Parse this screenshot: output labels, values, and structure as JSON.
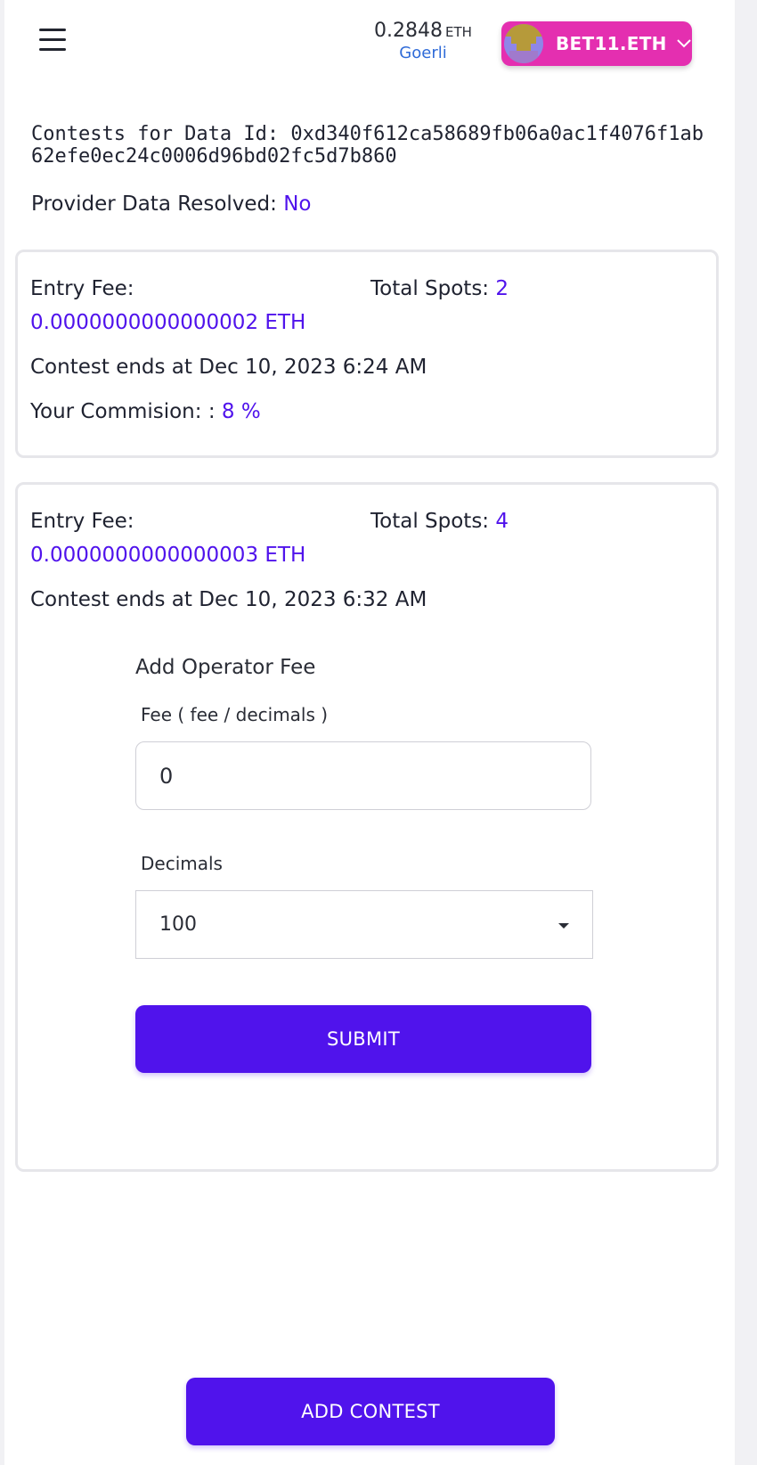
{
  "header": {
    "balance_amount": "0.2848",
    "balance_unit": "ETH",
    "network": "Goerli",
    "account_name": "BET11.ETH"
  },
  "page": {
    "data_id_label": "Contests for Data Id: 0xd340f612ca58689fb06a0ac1f4076f1ab62efe0ec24c0006d96bd02fc5d7b860",
    "resolved_label": "Provider Data Resolved: ",
    "resolved_value": "No"
  },
  "contests": [
    {
      "entry_fee_label": "Entry Fee:",
      "entry_fee_value": "0.0000000000000002 ETH",
      "total_spots_label": "Total Spots: ",
      "total_spots_value": "2",
      "ends_text": "Contest ends at Dec 10, 2023 6:24 AM",
      "commission_label": "Your Commision: : ",
      "commission_value": "8 %"
    },
    {
      "entry_fee_label": "Entry Fee:",
      "entry_fee_value": "0.0000000000000003 ETH",
      "total_spots_label": "Total Spots: ",
      "total_spots_value": "4",
      "ends_text": "Contest ends at Dec 10, 2023 6:32 AM"
    }
  ],
  "operator_form": {
    "title": "Add Operator Fee",
    "fee_label": "Fee ( fee / decimals )",
    "fee_value": "0",
    "decimals_label": "Decimals",
    "decimals_value": "100",
    "submit_label": "SUBMIT"
  },
  "footer": {
    "add_contest_label": "ADD CONTEST"
  },
  "colors": {
    "accent": "#5013ec",
    "account_button": "#e42fb0",
    "network": "#2f6bd8"
  },
  "icons": [
    "menu-icon",
    "avatar-identicon",
    "chevron-down-icon",
    "caret-down-icon"
  ]
}
